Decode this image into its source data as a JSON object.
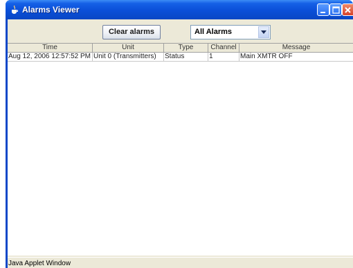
{
  "window": {
    "title": "Alarms Viewer",
    "icon": "java-coffee-icon"
  },
  "toolbar": {
    "clear_label": "Clear alarms",
    "filter_selected": "All Alarms"
  },
  "table": {
    "columns": [
      "Time",
      "Unit",
      "Type",
      "Channel",
      "Message"
    ],
    "rows": [
      [
        "Aug 12, 2006 12:57:52 PM",
        "Unit 0 (Transmitters)",
        "Status",
        "1",
        "Main XMTR OFF"
      ]
    ]
  },
  "status": {
    "text": "Java Applet Window"
  },
  "colors": {
    "titlebar": "#0a4fd8",
    "client_bg": "#ece9d8",
    "close_button": "#d5412a"
  }
}
